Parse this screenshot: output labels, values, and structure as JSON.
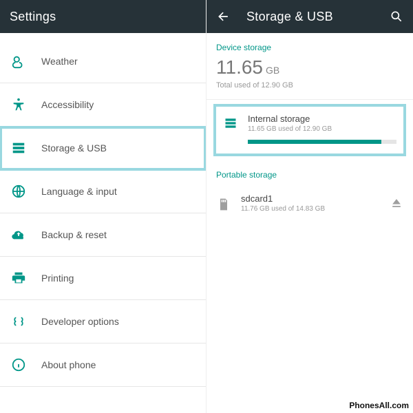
{
  "left": {
    "title": "Settings",
    "items": [
      {
        "label": "Weather",
        "icon": "weather-icon"
      },
      {
        "label": "Accessibility",
        "icon": "accessibility-icon"
      },
      {
        "label": "Storage & USB",
        "icon": "storage-icon",
        "highlight": true
      },
      {
        "label": "Language & input",
        "icon": "language-icon"
      },
      {
        "label": "Backup & reset",
        "icon": "backup-icon"
      },
      {
        "label": "Printing",
        "icon": "printing-icon"
      },
      {
        "label": "Developer options",
        "icon": "developer-icon"
      },
      {
        "label": "About phone",
        "icon": "about-icon"
      }
    ]
  },
  "right": {
    "title": "Storage & USB",
    "device_section_label": "Device storage",
    "total_used_value": "11.65",
    "total_used_unit": "GB",
    "total_sub": "Total used of 12.90 GB",
    "internal": {
      "title": "Internal storage",
      "sub": "11.65 GB used of 12.90 GB",
      "percent": 90
    },
    "portable_section_label": "Portable storage",
    "sd": {
      "title": "sdcard1",
      "sub": "11.76 GB used of 14.83 GB"
    }
  },
  "watermark": "PhonesAll.com",
  "colors": {
    "accent": "#009688",
    "header": "#263238",
    "highlight_border": "#99d8e0"
  }
}
